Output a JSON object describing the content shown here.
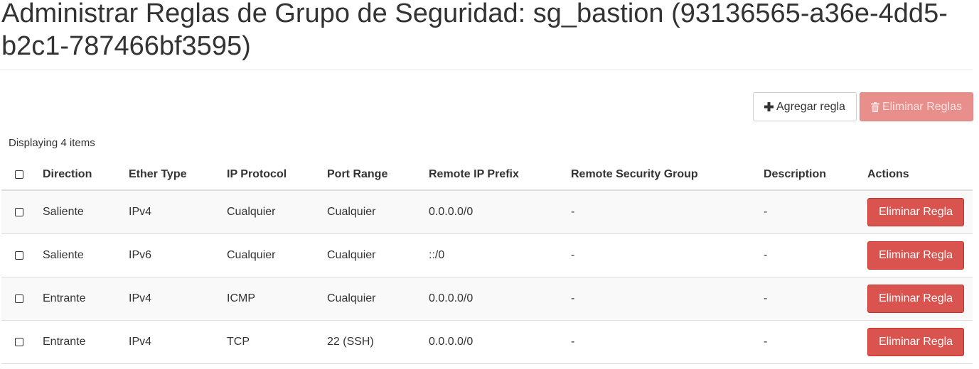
{
  "page": {
    "title": "Administrar Reglas de Grupo de Seguridad: sg_bastion (93136565-a36e-4dd5-b2c1-787466bf3595)"
  },
  "toolbar": {
    "add_rule_label": "Agregar regla",
    "add_rule_icon": "plus-icon",
    "delete_rules_label": "Eliminar Reglas",
    "delete_rules_icon": "trash-icon"
  },
  "table": {
    "count_label": "Displaying 4 items",
    "headers": {
      "direction": "Direction",
      "ether_type": "Ether Type",
      "ip_protocol": "IP Protocol",
      "port_range": "Port Range",
      "remote_ip_prefix": "Remote IP Prefix",
      "remote_security_group": "Remote Security Group",
      "description": "Description",
      "actions": "Actions"
    },
    "rows": [
      {
        "direction": "Saliente",
        "ether_type": "IPv4",
        "ip_protocol": "Cualquier",
        "port_range": "Cualquier",
        "remote_ip_prefix": "0.0.0.0/0",
        "remote_security_group": "-",
        "description": "-",
        "action_label": "Eliminar Regla"
      },
      {
        "direction": "Saliente",
        "ether_type": "IPv6",
        "ip_protocol": "Cualquier",
        "port_range": "Cualquier",
        "remote_ip_prefix": "::/0",
        "remote_security_group": "-",
        "description": "-",
        "action_label": "Eliminar Regla"
      },
      {
        "direction": "Entrante",
        "ether_type": "IPv4",
        "ip_protocol": "ICMP",
        "port_range": "Cualquier",
        "remote_ip_prefix": "0.0.0.0/0",
        "remote_security_group": "-",
        "description": "-",
        "action_label": "Eliminar Regla"
      },
      {
        "direction": "Entrante",
        "ether_type": "IPv4",
        "ip_protocol": "TCP",
        "port_range": "22 (SSH)",
        "remote_ip_prefix": "0.0.0.0/0",
        "remote_security_group": "-",
        "description": "-",
        "action_label": "Eliminar Regla"
      }
    ]
  },
  "colors": {
    "danger": "#d9534f",
    "danger_disabled": "#e88e8b",
    "text": "#333333",
    "row_stripe": "#f9f9f9"
  }
}
